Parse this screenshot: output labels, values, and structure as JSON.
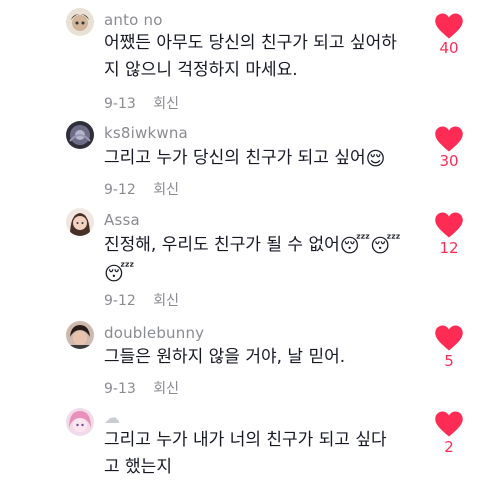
{
  "colors": {
    "accent": "#fe2c55",
    "text": "#161823",
    "muted": "#8a8b91"
  },
  "comments": [
    {
      "username": "anto no",
      "avatar_icon": "avatar-icon",
      "text_lines": [
        "어쨌든 아무도 당신의 친구가 되고 싶어하",
        "지 않으니 걱정하지 마세요."
      ],
      "date": "9-13",
      "reply_label": "회신",
      "likes": "40"
    },
    {
      "username": "ks8iwkwna",
      "avatar_icon": "avatar-icon",
      "text": "그리고 누가 당신의 친구가 되고 싶어",
      "emoji": "😌",
      "date": "9-12",
      "reply_label": "회신",
      "likes": "30"
    },
    {
      "username": "Assa",
      "avatar_icon": "avatar-icon",
      "text": "진정해, 우리도 친구가 될 수 없어",
      "emoji": "😴😴",
      "emoji2": "😴",
      "date": "9-12",
      "reply_label": "회신",
      "likes": "12"
    },
    {
      "username": "doublebunny",
      "avatar_icon": "avatar-icon",
      "text": "그들은 원하지 않을 거야, 날 믿어.",
      "date": "9-13",
      "reply_label": "회신",
      "likes": "5"
    },
    {
      "username_icon": "cloud-icon",
      "username_glyph": "☁",
      "avatar_icon": "avatar-icon",
      "text_lines": [
        "그리고 누가 내가 너의 친구가 되고 싶다",
        "고 했는지"
      ],
      "likes": "2"
    }
  ]
}
